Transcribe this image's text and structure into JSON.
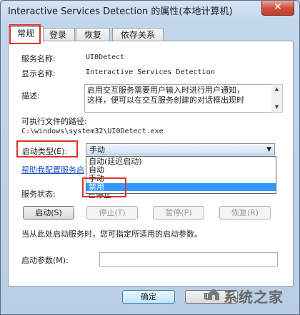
{
  "window": {
    "title": "Interactive Services Detection 的属性(本地计算机)",
    "close_glyph": "✕"
  },
  "tabs": [
    {
      "label": "常规",
      "active": true
    },
    {
      "label": "登录",
      "active": false
    },
    {
      "label": "恢复",
      "active": false
    },
    {
      "label": "依存关系",
      "active": false
    }
  ],
  "general": {
    "service_name_label": "服务名称:",
    "service_name_value": "UI0Detect",
    "display_name_label": "显示名称:",
    "display_name_value": "Interactive Services Detection",
    "description_label": "描述:",
    "description_lines": [
      "启用交互服务需要用户输入时进行用户通知，",
      "这样，便可以在交互服务创建的对话框出现时"
    ],
    "exec_path_label": "可执行文件的路径:",
    "exec_path_value": "C:\\windows\\system32\\UI0Detect.exe",
    "startup_type_label": "启动类型(E):",
    "startup_type_value": "手动",
    "startup_options": [
      {
        "label": "自动(延迟启动)",
        "selected": false
      },
      {
        "label": "自动",
        "selected": false
      },
      {
        "label": "手动",
        "selected": false
      },
      {
        "label": "禁用",
        "selected": true
      }
    ],
    "help_link": "帮助我配置服务启",
    "service_status_label": "服务状态:",
    "service_status_value": "已停止",
    "buttons": {
      "start": "启动(S)",
      "stop": "停止(T)",
      "pause": "暂停(P)",
      "resume": "恢复(R)"
    },
    "hint": "当从此处启动服务时，您可指定所适用的启动参数。",
    "params_label": "启动参数(M):",
    "params_value": ""
  },
  "footer": {
    "ok": "确定",
    "cancel": "取消"
  },
  "watermark": {
    "text": "系统之家"
  },
  "highlight_color": "#e0302a"
}
